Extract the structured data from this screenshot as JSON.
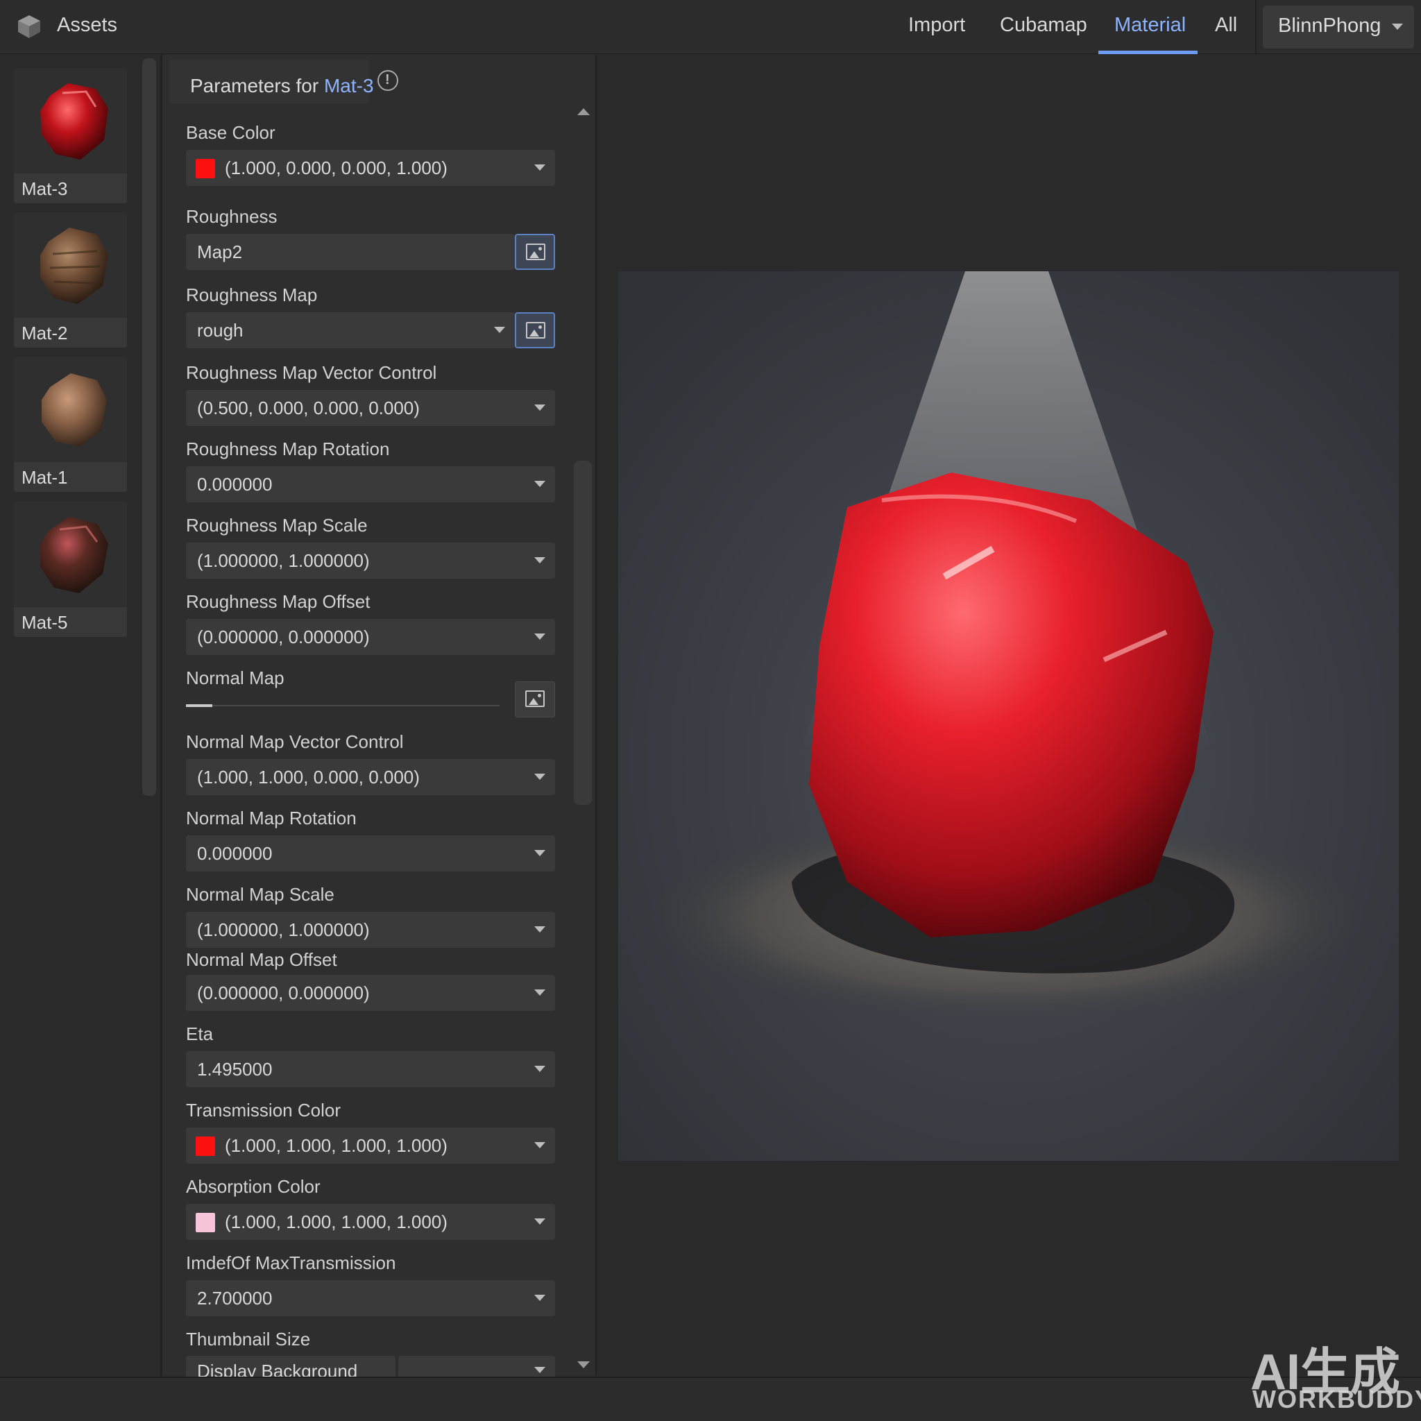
{
  "header": {
    "app_title": "Assets",
    "tabs": [
      {
        "label": "Import"
      },
      {
        "label": "Cubamap"
      },
      {
        "label": "Material"
      },
      {
        "label": "All"
      }
    ],
    "active_tab": "Material",
    "shader_select": {
      "value": "BlinnPhong",
      "icon": "chevron-down-icon"
    },
    "accent_color": "#8fb4ff"
  },
  "assets": [
    {
      "name": "Mat-3"
    },
    {
      "name": "Mat-2"
    },
    {
      "name": "Mat-1"
    },
    {
      "name": "Mat-5"
    }
  ],
  "panel": {
    "title_prefix": "Parameters for",
    "material_name": "Mat-3",
    "params": {
      "base_color": {
        "label": "Base Color",
        "value": "(1.000, 0.000, 0.000, 1.000)",
        "swatch": "#ff1010"
      },
      "roughness": {
        "label": "Roughness",
        "value": "Map2"
      },
      "roughness_map": {
        "label": "Roughness Map",
        "value": "rough"
      },
      "roughness_map_vector": {
        "label": "Roughness Map Vector Control",
        "value": "(0.500, 0.000, 0.000, 0.000)"
      },
      "roughness_map_rotation": {
        "label": "Roughness Map Rotation",
        "value": "0.000000"
      },
      "roughness_map_scale": {
        "label": "Roughness Map Scale",
        "value": "(1.000000, 1.000000)"
      },
      "roughness_map_offset": {
        "label": "Roughness Map Offset",
        "value": "(0.000000, 0.000000)"
      },
      "normal_map": {
        "label": "Normal Map"
      },
      "normal_map_vector": {
        "label": "Normal Map Vector Control",
        "value": "(1.000, 1.000, 0.000, 0.000)"
      },
      "normal_map_rotation": {
        "label": "Normal Map Rotation",
        "value": "0.000000"
      },
      "normal_map_scale": {
        "label": "Normal Map Scale",
        "value": "(1.000000, 1.000000)"
      },
      "normal_map_offset": {
        "label": "Normal Map Offset",
        "value": "(0.000000, 0.000000)"
      },
      "eta": {
        "label": "Eta",
        "value": "1.495000"
      },
      "transmission_color": {
        "label": "Transmission Color",
        "value": "(1.000, 1.000, 1.000, 1.000)",
        "swatch": "#ff1010"
      },
      "absorption_color": {
        "label": "Absorption Color",
        "value": "(1.000, 1.000, 1.000, 1.000)",
        "swatch": "#f6c6d8"
      },
      "imdef_max_transmission": {
        "label": "ImdefOf MaxTransmission",
        "value": "2.700000"
      },
      "thumbnail_size": {
        "label": "Thumbnail Size",
        "value": "Display Background"
      }
    }
  },
  "watermark": {
    "line1": "AI生成",
    "line2": "WORKBUDDY"
  }
}
